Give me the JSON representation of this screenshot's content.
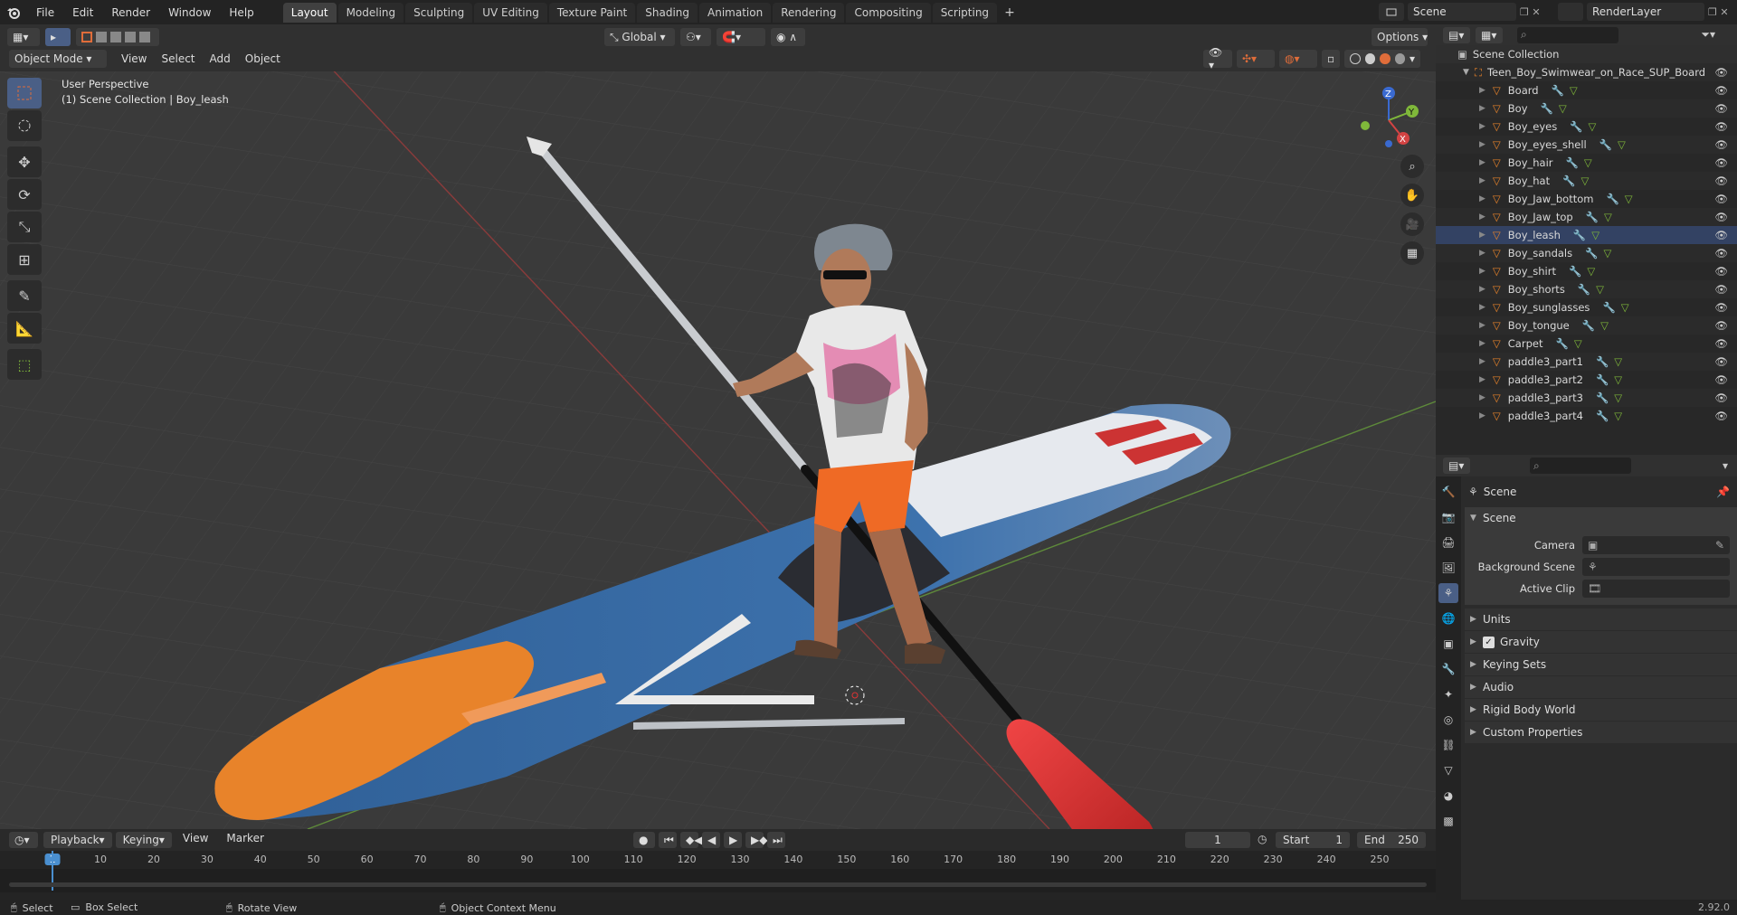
{
  "menu": [
    "File",
    "Edit",
    "Render",
    "Window",
    "Help"
  ],
  "workspaces": [
    "Layout",
    "Modeling",
    "Sculpting",
    "UV Editing",
    "Texture Paint",
    "Shading",
    "Animation",
    "Rendering",
    "Compositing",
    "Scripting"
  ],
  "active_workspace": "Layout",
  "scene_name": "Scene",
  "render_layer": "RenderLayer",
  "header": {
    "mode": "Object Mode",
    "menus": [
      "View",
      "Select",
      "Add",
      "Object"
    ],
    "transform": "Global",
    "options": "Options"
  },
  "viewport": {
    "view_name": "User Perspective",
    "collection_info": "(1) Scene Collection | Boy_leash"
  },
  "outliner": {
    "root": "Scene Collection",
    "collection": "Teen_Boy_Swimwear_on_Race_SUP_Board",
    "objects": [
      "Board",
      "Boy",
      "Boy_eyes",
      "Boy_eyes_shell",
      "Boy_hair",
      "Boy_hat",
      "Boy_Jaw_bottom",
      "Boy_Jaw_top",
      "Boy_leash",
      "Boy_sandals",
      "Boy_shirt",
      "Boy_shorts",
      "Boy_sunglasses",
      "Boy_tongue",
      "Carpet",
      "paddle3_part1",
      "paddle3_part2",
      "paddle3_part3",
      "paddle3_part4"
    ]
  },
  "properties": {
    "context": "Scene",
    "panel": "Scene",
    "camera_label": "Camera",
    "bg_scene_label": "Background Scene",
    "active_clip_label": "Active Clip",
    "sections": [
      "Units",
      "Gravity",
      "Keying Sets",
      "Audio",
      "Rigid Body World",
      "Custom Properties"
    ]
  },
  "timeline": {
    "menus": [
      "Playback",
      "Keying",
      "View",
      "Marker"
    ],
    "current_frame": "1",
    "start_label": "Start",
    "start": "1",
    "end_label": "End",
    "end": "250",
    "ticks": [
      "1",
      "10",
      "20",
      "30",
      "40",
      "50",
      "60",
      "70",
      "80",
      "90",
      "100",
      "110",
      "120",
      "130",
      "140",
      "150",
      "160",
      "170",
      "180",
      "190",
      "200",
      "210",
      "220",
      "230",
      "240",
      "250"
    ]
  },
  "status": {
    "select": "Select",
    "box_select": "Box Select",
    "rotate": "Rotate View",
    "context_menu": "Object Context Menu",
    "version": "2.92.0"
  },
  "colors": {
    "accent": "#4a5f86",
    "orange": "#e8832a",
    "board_blue": "#3d6fa8",
    "paddle_red": "#d33232"
  }
}
